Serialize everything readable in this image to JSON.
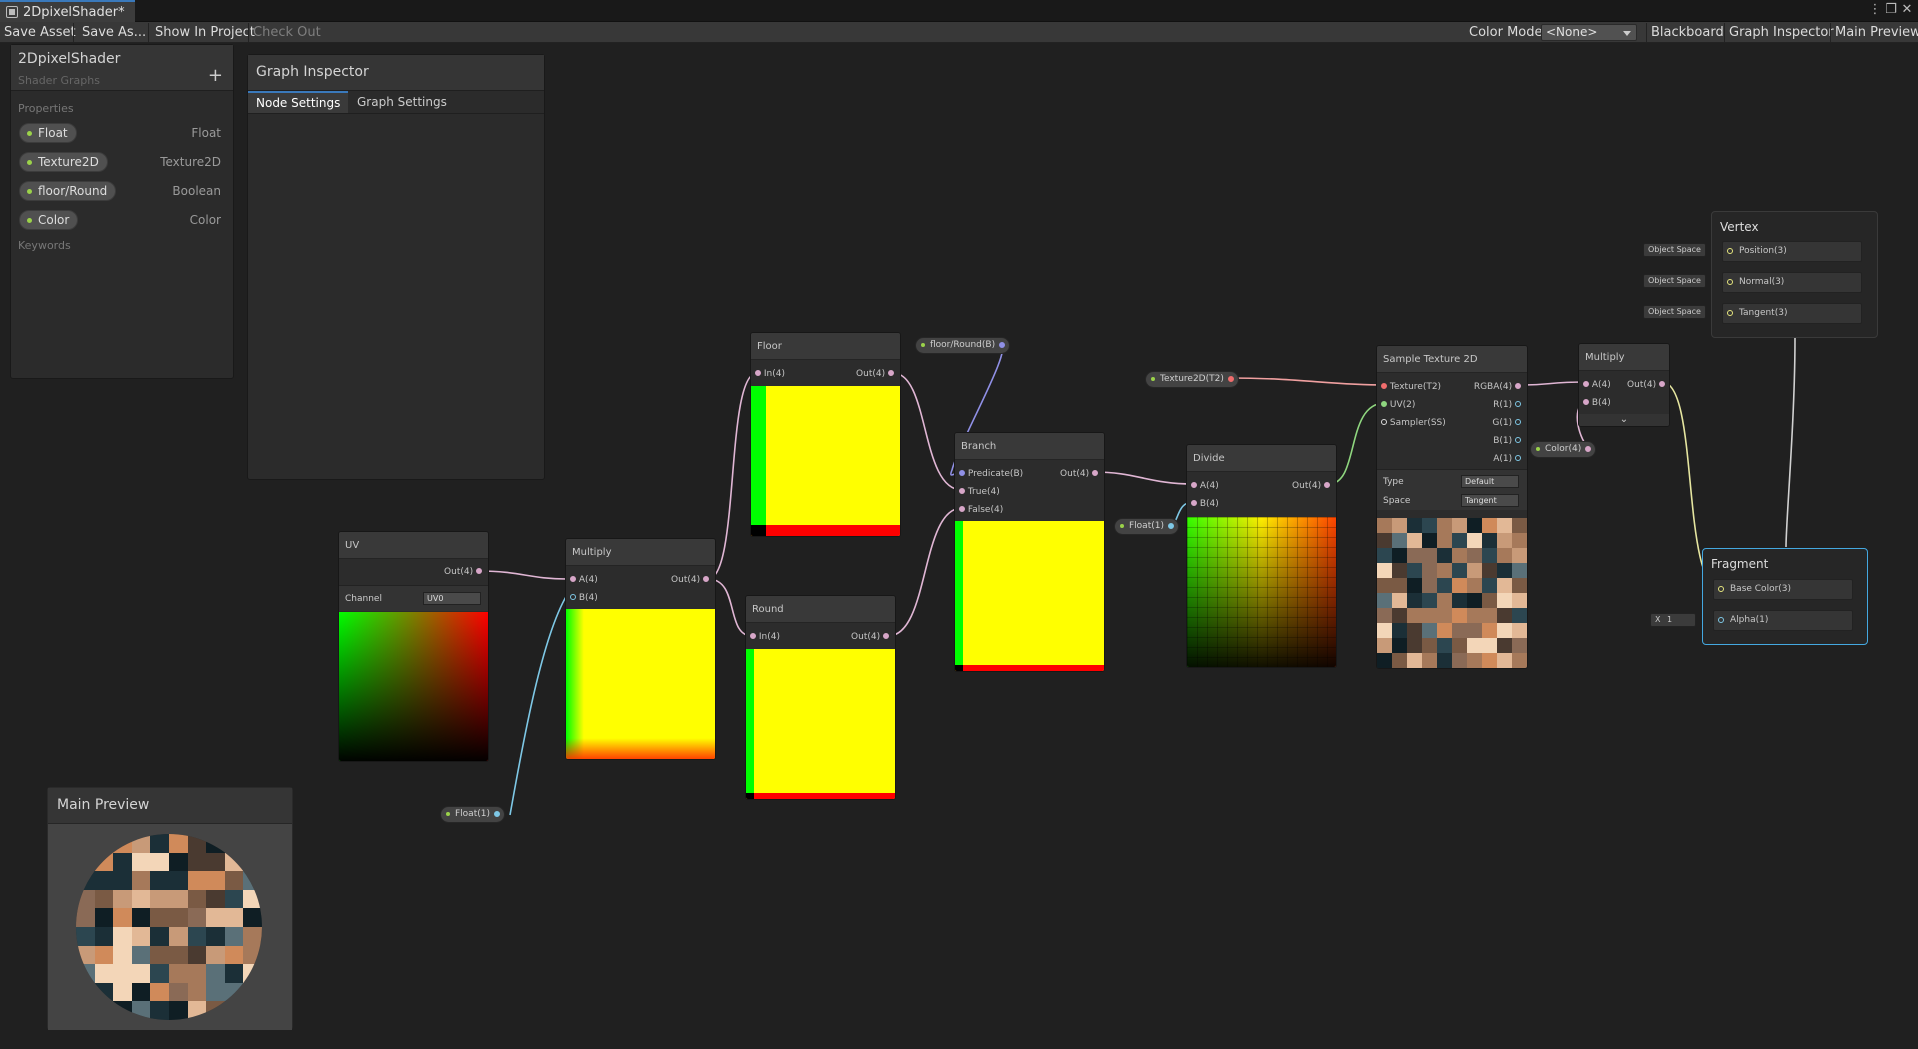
{
  "window": {
    "tab_title": "2DpixelShader*",
    "ctrl_menu": "⋮",
    "ctrl_max": "❐",
    "ctrl_close": "✕"
  },
  "toolbar": {
    "save_asset": "Save Asset",
    "save_as": "Save As...",
    "show_in_project": "Show In Project",
    "check_out": "Check Out",
    "color_mode_label": "Color Mode",
    "color_mode_value": "<None>",
    "blackboard": "Blackboard",
    "graph_inspector": "Graph Inspector",
    "main_preview": "Main Preview"
  },
  "blackboard": {
    "title": "2DpixelShader",
    "subtitle": "Shader Graphs",
    "add": "+",
    "properties_header": "Properties",
    "keywords_header": "Keywords",
    "properties": [
      {
        "name": "Float",
        "type": "Float"
      },
      {
        "name": "Texture2D",
        "type": "Texture2D"
      },
      {
        "name": "floor/Round",
        "type": "Boolean"
      },
      {
        "name": "Color",
        "type": "Color"
      }
    ]
  },
  "inspector": {
    "title": "Graph Inspector",
    "tabs": [
      "Node Settings",
      "Graph Settings"
    ]
  },
  "main_preview": {
    "title": "Main Preview"
  },
  "nodes": {
    "uv": {
      "title": "UV",
      "out": "Out(4)",
      "channel_label": "Channel",
      "channel_value": "UV0"
    },
    "multiply1": {
      "title": "Multiply",
      "a": "A(4)",
      "b": "B(4)",
      "out": "Out(4)"
    },
    "floor": {
      "title": "Floor",
      "in": "In(4)",
      "out": "Out(4)"
    },
    "round": {
      "title": "Round",
      "in": "In(4)",
      "out": "Out(4)"
    },
    "branch": {
      "title": "Branch",
      "predicate": "Predicate(B)",
      "true": "True(4)",
      "false": "False(4)",
      "out": "Out(4)"
    },
    "divide": {
      "title": "Divide",
      "a": "A(4)",
      "b": "B(4)",
      "out": "Out(4)"
    },
    "sample": {
      "title": "Sample Texture 2D",
      "texture": "Texture(T2)",
      "uv": "UV(2)",
      "sampler": "Sampler(SS)",
      "rgba": "RGBA(4)",
      "r": "R(1)",
      "g": "G(1)",
      "b": "B(1)",
      "a": "A(1)",
      "type_label": "Type",
      "type_value": "Default",
      "space_label": "Space",
      "space_value": "Tangent"
    },
    "multiply2": {
      "title": "Multiply",
      "a": "A(4)",
      "b": "B(4)",
      "out": "Out(4)",
      "expand": "⌄"
    }
  },
  "property_nodes": {
    "floor_round": "floor/Round(B)",
    "texture2d": "Texture2D(T2)",
    "float_divide": "Float(1)",
    "float_multiply": "Float(1)",
    "color": "Color(4)"
  },
  "vertex": {
    "title": "Vertex",
    "slots": [
      "Position(3)",
      "Normal(3)",
      "Tangent(3)"
    ],
    "space": "Object Space"
  },
  "fragment": {
    "title": "Fragment",
    "slots": [
      "Base Color(3)",
      "Alpha(1)"
    ],
    "alpha_x": "X",
    "alpha_value": "1"
  },
  "colors": {
    "accent": "#3a79bb",
    "selected": "#44a8e0",
    "yellow": "#ffff00",
    "green": "#00ff00",
    "red": "#ff0000"
  }
}
